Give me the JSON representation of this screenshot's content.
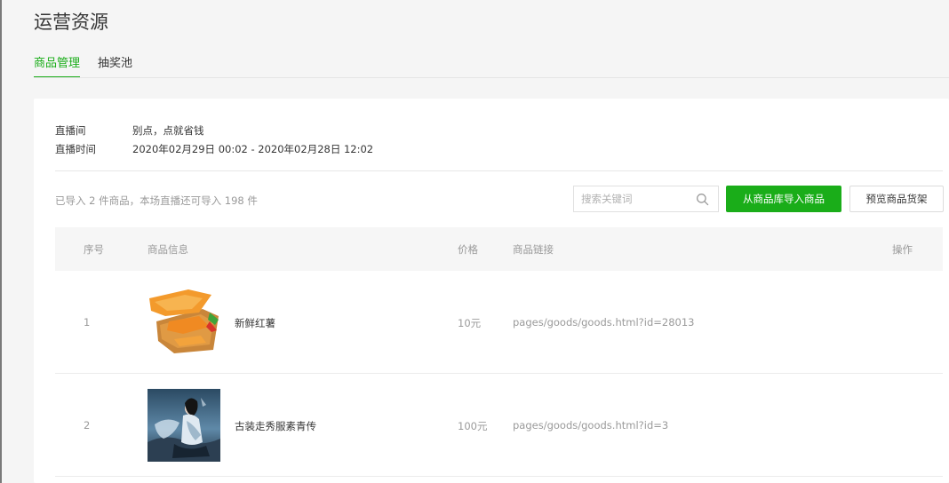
{
  "header": {
    "title": "运营资源"
  },
  "tabs": [
    {
      "label": "商品管理",
      "active": true
    },
    {
      "label": "抽奖池",
      "active": false
    }
  ],
  "live_info": {
    "room_label": "直播间",
    "room_value": "别点，点就省钱",
    "time_label": "直播时间",
    "time_value": "2020年02月29日 00:02 - 2020年02月28日 12:02"
  },
  "toolbar": {
    "summary": "已导入 2 件商品，本场直播还可导入 198 件",
    "search_placeholder": "搜索关键词",
    "import_label": "从商品库导入商品",
    "preview_label": "预览商品货架"
  },
  "table": {
    "columns": {
      "index": "序号",
      "info": "商品信息",
      "price": "价格",
      "link": "商品链接",
      "action": "操作"
    },
    "rows": [
      {
        "index": "1",
        "name": "新鲜红薯",
        "price": "10元",
        "link": "pages/goods/goods.html?id=28013",
        "thumb_icon": "sweet-potato-image"
      },
      {
        "index": "2",
        "name": "古装走秀服素青传",
        "price": "100元",
        "link": "pages/goods/goods.html?id=3",
        "thumb_icon": "costume-photo-image"
      }
    ]
  },
  "colors": {
    "accent": "#1aad19",
    "muted_text": "#9a9a9a",
    "header_bg": "#f6f6f6"
  }
}
